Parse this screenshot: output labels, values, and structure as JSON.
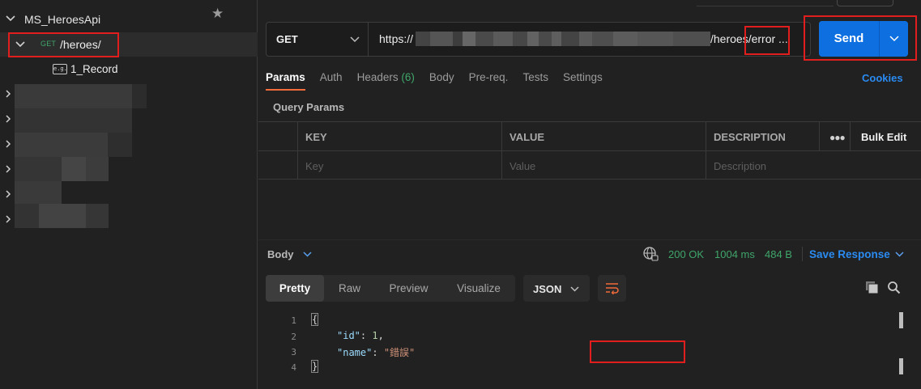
{
  "sidebar": {
    "collection_name": "MS_HeroesApi",
    "request": {
      "method": "GET",
      "path": "/heroes/"
    },
    "example": {
      "icon_text": "e.g.",
      "name": "1_Record"
    }
  },
  "request_bar": {
    "method": "GET",
    "url_prefix": "https://",
    "url_suffix": "/heroes/error ...",
    "send_label": "Send"
  },
  "tabs": [
    {
      "label": "Params",
      "active": true
    },
    {
      "label": "Auth"
    },
    {
      "label": "Headers",
      "count": "(6)"
    },
    {
      "label": "Body"
    },
    {
      "label": "Pre-req."
    },
    {
      "label": "Tests"
    },
    {
      "label": "Settings"
    }
  ],
  "cookies_label": "Cookies",
  "query_params": {
    "title": "Query Params",
    "headers": {
      "key": "KEY",
      "value": "VALUE",
      "description": "DESCRIPTION",
      "bulk_edit": "Bulk Edit"
    },
    "placeholders": {
      "key": "Key",
      "value": "Value",
      "description": "Description"
    }
  },
  "response": {
    "body_label": "Body",
    "status": "200 OK",
    "time": "1004 ms",
    "size": "484 B",
    "save_label": "Save Response",
    "view_tabs": [
      "Pretty",
      "Raw",
      "Preview",
      "Visualize"
    ],
    "active_view": "Pretty",
    "language": "JSON",
    "line_numbers": [
      "1",
      "2",
      "3",
      "4"
    ],
    "code": {
      "open": "{",
      "id_key": "\"id\"",
      "id_value": "1",
      "name_key": "\"name\"",
      "name_value": "\"錯誤\"",
      "close": "}"
    }
  },
  "colors": {
    "accent_blue": "#0d6fe0",
    "success_green": "#3fa66a",
    "highlight_red": "#e01e1e",
    "tab_underline": "#f26b3a"
  }
}
